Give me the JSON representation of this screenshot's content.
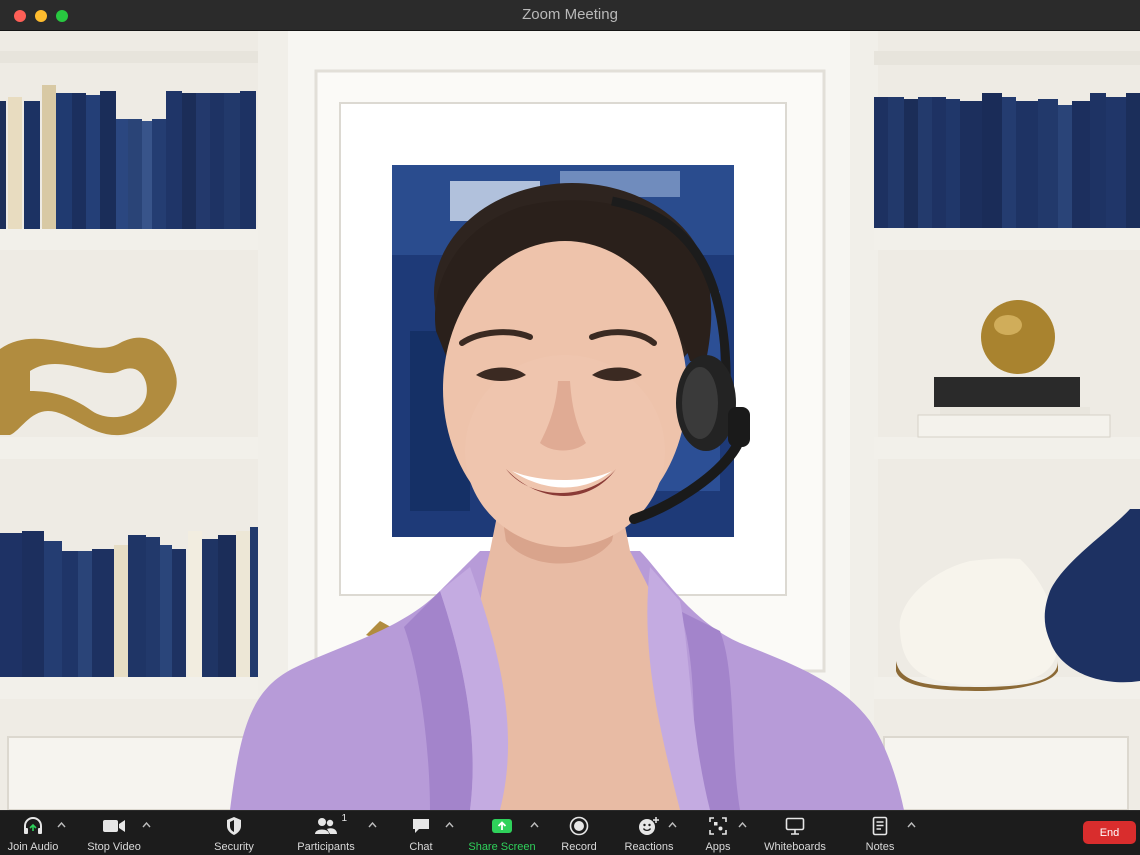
{
  "window": {
    "title": "Zoom Meeting"
  },
  "toolbar": {
    "join_audio": "Join Audio",
    "stop_video": "Stop Video",
    "security": "Security",
    "participants": "Participants",
    "participants_count": "1",
    "chat": "Chat",
    "share_screen": "Share Screen",
    "record": "Record",
    "reactions": "Reactions",
    "apps": "Apps",
    "whiteboards": "Whiteboards",
    "notes": "Notes",
    "end": "End"
  },
  "icons": {
    "join_audio": "headphones-icon",
    "stop_video": "video-camera-icon",
    "security": "shield-icon",
    "participants": "people-icon",
    "chat": "chat-bubble-icon",
    "share_screen": "share-arrow-icon",
    "record": "record-circle-icon",
    "reactions": "smiley-plus-icon",
    "apps": "apps-grid-icon",
    "whiteboards": "whiteboard-icon",
    "notes": "notes-icon",
    "caret": "chevron-up-icon"
  },
  "colors": {
    "share_screen_accent": "#2fd15b",
    "end_button": "#d92d2d",
    "toolbar_bg": "#1c1c1c"
  }
}
